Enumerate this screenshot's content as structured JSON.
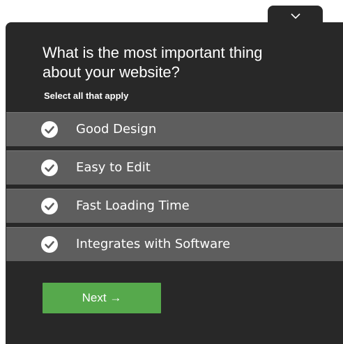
{
  "widget": {
    "collapse_icon": "chevron-down-icon",
    "question": "What is the most important thing about your website?",
    "hint": "Select all that apply",
    "options": [
      {
        "label": "Good Design",
        "checked": true
      },
      {
        "label": "Easy to Edit",
        "checked": true
      },
      {
        "label": "Fast Loading Time",
        "checked": true
      },
      {
        "label": "Integrates with Software",
        "checked": true
      }
    ],
    "next_label": "Next →"
  },
  "colors": {
    "panel_bg": "#282828",
    "option_bg": "#5e5e5e",
    "next_bg": "#56a94c",
    "text": "#ffffff"
  }
}
